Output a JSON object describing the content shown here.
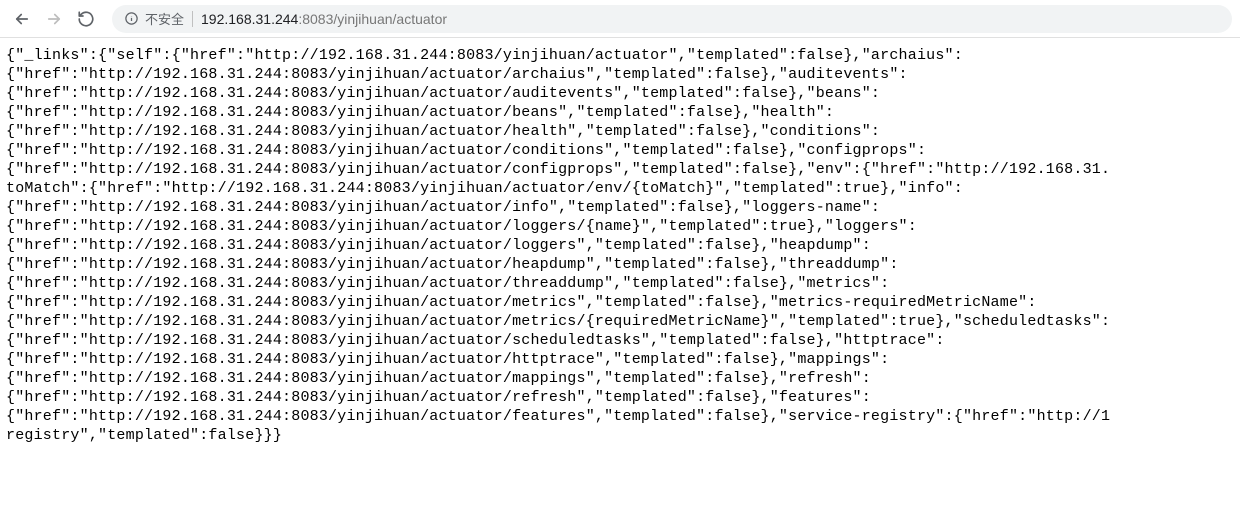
{
  "toolbar": {
    "insecure_label": "不安全",
    "url_host": "192.168.31.244",
    "url_port": ":8083",
    "url_path": "/yinjihuan/actuator"
  },
  "page_body": "{\"_links\":{\"self\":{\"href\":\"http://192.168.31.244:8083/yinjihuan/actuator\",\"templated\":false},\"archaius\":\n{\"href\":\"http://192.168.31.244:8083/yinjihuan/actuator/archaius\",\"templated\":false},\"auditevents\":\n{\"href\":\"http://192.168.31.244:8083/yinjihuan/actuator/auditevents\",\"templated\":false},\"beans\":\n{\"href\":\"http://192.168.31.244:8083/yinjihuan/actuator/beans\",\"templated\":false},\"health\":\n{\"href\":\"http://192.168.31.244:8083/yinjihuan/actuator/health\",\"templated\":false},\"conditions\":\n{\"href\":\"http://192.168.31.244:8083/yinjihuan/actuator/conditions\",\"templated\":false},\"configprops\":\n{\"href\":\"http://192.168.31.244:8083/yinjihuan/actuator/configprops\",\"templated\":false},\"env\":{\"href\":\"http://192.168.31.\ntoMatch\":{\"href\":\"http://192.168.31.244:8083/yinjihuan/actuator/env/{toMatch}\",\"templated\":true},\"info\":\n{\"href\":\"http://192.168.31.244:8083/yinjihuan/actuator/info\",\"templated\":false},\"loggers-name\":\n{\"href\":\"http://192.168.31.244:8083/yinjihuan/actuator/loggers/{name}\",\"templated\":true},\"loggers\":\n{\"href\":\"http://192.168.31.244:8083/yinjihuan/actuator/loggers\",\"templated\":false},\"heapdump\":\n{\"href\":\"http://192.168.31.244:8083/yinjihuan/actuator/heapdump\",\"templated\":false},\"threaddump\":\n{\"href\":\"http://192.168.31.244:8083/yinjihuan/actuator/threaddump\",\"templated\":false},\"metrics\":\n{\"href\":\"http://192.168.31.244:8083/yinjihuan/actuator/metrics\",\"templated\":false},\"metrics-requiredMetricName\":\n{\"href\":\"http://192.168.31.244:8083/yinjihuan/actuator/metrics/{requiredMetricName}\",\"templated\":true},\"scheduledtasks\":\n{\"href\":\"http://192.168.31.244:8083/yinjihuan/actuator/scheduledtasks\",\"templated\":false},\"httptrace\":\n{\"href\":\"http://192.168.31.244:8083/yinjihuan/actuator/httptrace\",\"templated\":false},\"mappings\":\n{\"href\":\"http://192.168.31.244:8083/yinjihuan/actuator/mappings\",\"templated\":false},\"refresh\":\n{\"href\":\"http://192.168.31.244:8083/yinjihuan/actuator/refresh\",\"templated\":false},\"features\":\n{\"href\":\"http://192.168.31.244:8083/yinjihuan/actuator/features\",\"templated\":false},\"service-registry\":{\"href\":\"http://1\nregistry\",\"templated\":false}}}"
}
